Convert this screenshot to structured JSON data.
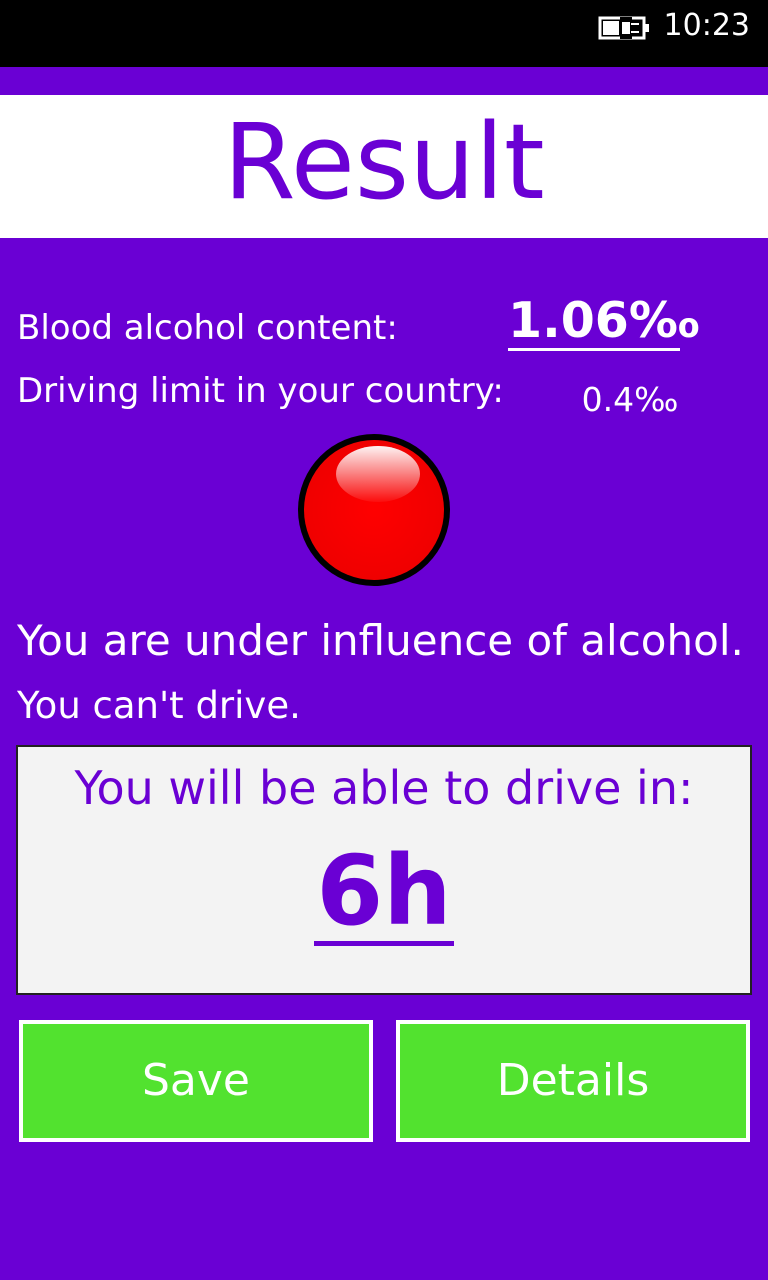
{
  "status_bar": {
    "time": "10:23",
    "icon": "battery-charging-icon"
  },
  "title": "Result",
  "bac": {
    "label": "Blood alcohol content:",
    "value": "1.06‰"
  },
  "limit": {
    "label": "Driving limit in your country:",
    "value": "0.4‰"
  },
  "indicator": {
    "icon": "red-light-icon",
    "color": "#ff0000"
  },
  "message": {
    "line1": "You are under influence of alcohol.",
    "line2": "You can't drive."
  },
  "drive_box": {
    "label": "You will be able to drive in:",
    "time": "6h"
  },
  "buttons": {
    "save": "Save",
    "details": "Details"
  },
  "colors": {
    "background": "#6a00d4",
    "accent": "#6a00d4",
    "button": "#52e22f",
    "box": "#f3f3f3"
  }
}
